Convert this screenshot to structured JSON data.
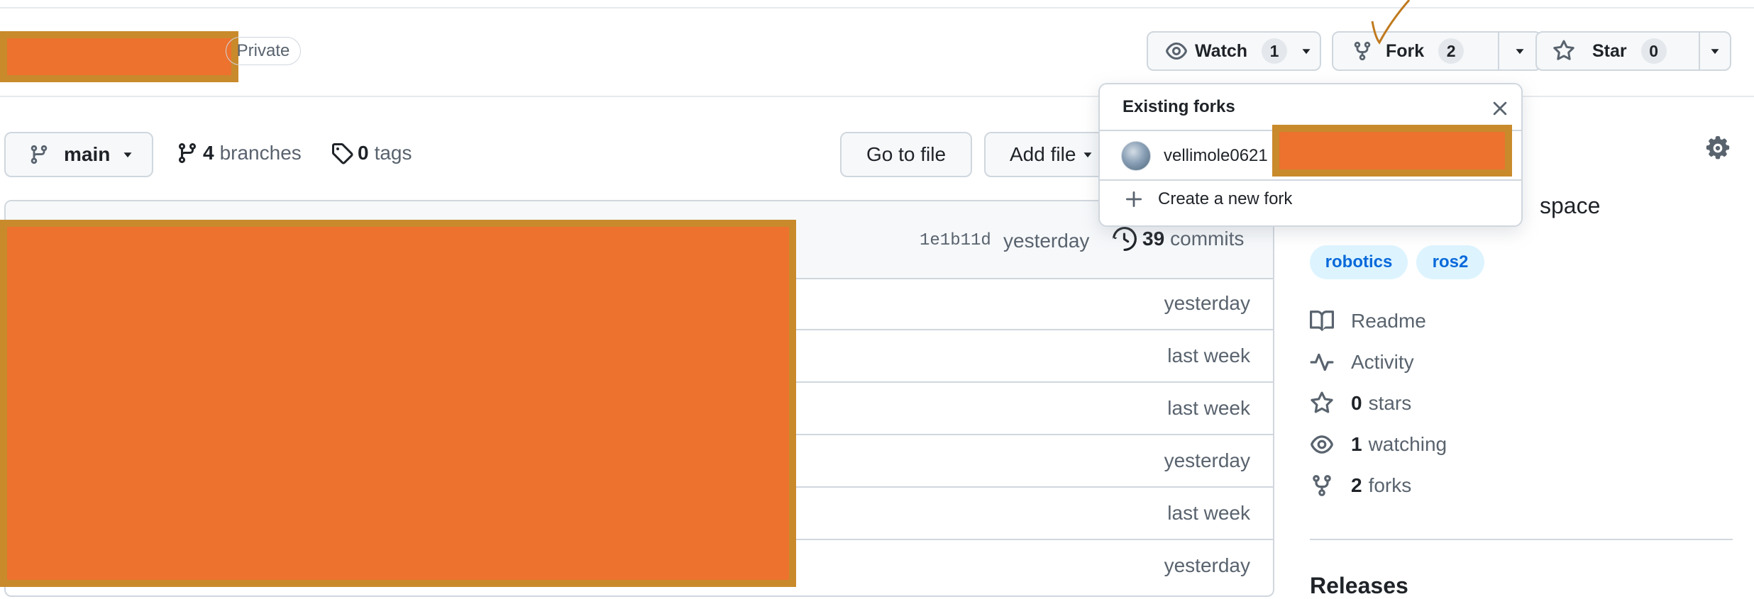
{
  "repo": {
    "visibility_badge": "Private"
  },
  "actions": {
    "watch": {
      "label": "Watch",
      "count": "1"
    },
    "fork": {
      "label": "Fork",
      "count": "2"
    },
    "star": {
      "label": "Star",
      "count": "0"
    }
  },
  "code_bar": {
    "branch": "main",
    "branches_count": "4",
    "branches_label": "branches",
    "tags_count": "0",
    "tags_label": "tags",
    "go_to_file": "Go to file",
    "add_file": "Add file"
  },
  "latest_commit": {
    "hash": "1e1b11d",
    "time": "yesterday",
    "commits_count": "39",
    "commits_label": "commits"
  },
  "file_rows": [
    {
      "time": "yesterday"
    },
    {
      "time": "last week"
    },
    {
      "time": "last week"
    },
    {
      "time": "yesterday"
    },
    {
      "time": "last week"
    },
    {
      "time": "yesterday"
    }
  ],
  "fork_popup": {
    "title": "Existing forks",
    "fork_owner": "vellimole0621",
    "create_label": "Create a new fork"
  },
  "about": {
    "description_fragment": "space",
    "topics": [
      "robotics",
      "ros2"
    ],
    "readme": "Readme",
    "activity": "Activity",
    "stars_count": "0",
    "stars_label": "stars",
    "watching_count": "1",
    "watching_label": "watching",
    "forks_count": "2",
    "forks_label": "forks",
    "releases_heading": "Releases"
  },
  "colors": {
    "accent": "#0969da",
    "redaction": "#ec722e",
    "border": "#d0d7de",
    "muted_text": "#59636e"
  }
}
